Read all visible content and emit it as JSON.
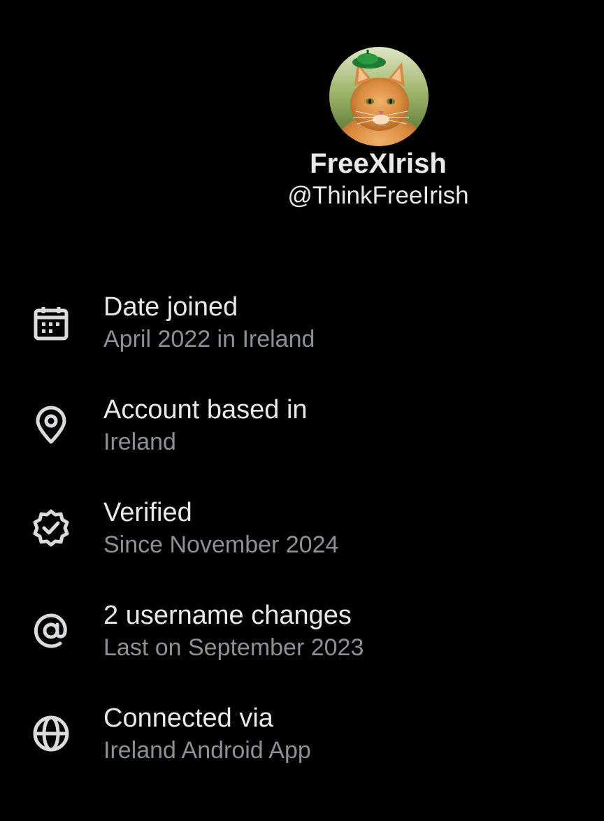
{
  "profile": {
    "display_name": "FreeXIrish",
    "handle": "@ThinkFreeIrish",
    "avatar_icon": "cat-avatar"
  },
  "info": [
    {
      "icon": "calendar-icon",
      "title": "Date joined",
      "subtitle": "April 2022 in Ireland"
    },
    {
      "icon": "location-pin-icon",
      "title": "Account based in",
      "subtitle": "Ireland"
    },
    {
      "icon": "verified-badge-icon",
      "title": "Verified",
      "subtitle": "Since November 2024"
    },
    {
      "icon": "at-sign-icon",
      "title": "2 username changes",
      "subtitle": "Last on September 2023"
    },
    {
      "icon": "globe-icon",
      "title": "Connected via",
      "subtitle": "Ireland Android App"
    }
  ],
  "colors": {
    "background": "#000000",
    "primary_text": "#e7e9ea",
    "secondary_text": "#8b9196",
    "icon": "#d9dbdc"
  }
}
